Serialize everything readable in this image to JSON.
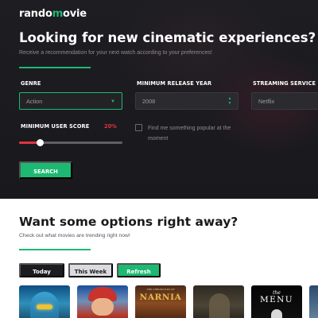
{
  "brand": {
    "prefix": "rando",
    "highlight": "m",
    "suffix": "ovie",
    "accent": "#1db972"
  },
  "hero": {
    "title": "Looking for new cinematic experiences?",
    "subtitle": "Receive a recommendation for your next watch according to your preferences!",
    "background": "#1b1b1f"
  },
  "form": {
    "genre": {
      "label": "GENRE",
      "value": "Action"
    },
    "year": {
      "label": "MINIMUM RELEASE YEAR",
      "value": "2008"
    },
    "streaming": {
      "label": "STREAMING SERVICE",
      "value": "Netflix"
    },
    "score": {
      "label": "MINIMUM USER SCORE",
      "value_text": "20%",
      "value": 0.2,
      "accent": "#e0343f"
    },
    "popular": {
      "label": "Find me something popular at the moment",
      "checked": false
    },
    "search_label": "SEARCH"
  },
  "trending": {
    "title": "Want some options right away?",
    "subtitle": "Check out what movies are trending right now!",
    "tabs": {
      "today": "Today",
      "week": "This Week",
      "refresh": "Refresh"
    },
    "active_tab": "Today",
    "posters": [
      {
        "name": "avatar-poster",
        "text": ""
      },
      {
        "name": "mario-poster",
        "text": ""
      },
      {
        "name": "narnia-poster",
        "small": "THE CHRONICLES OF",
        "text": "NARNIA"
      },
      {
        "name": "dark-poster",
        "text": ""
      },
      {
        "name": "menu-poster",
        "small": "the",
        "text": "MENU"
      },
      {
        "name": "partial-poster",
        "text": ""
      }
    ]
  }
}
